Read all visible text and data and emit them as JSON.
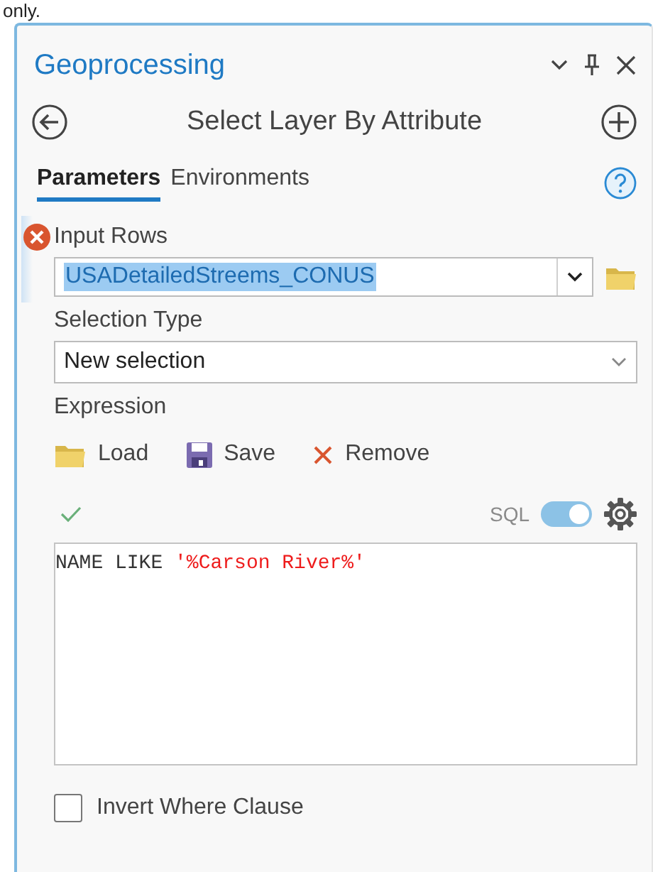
{
  "caption": "only.",
  "pane": {
    "title": "Geoprocessing"
  },
  "tool": {
    "title": "Select Layer By Attribute"
  },
  "tabs": [
    {
      "label": "Parameters",
      "selected": true
    },
    {
      "label": "Environments",
      "selected": false
    }
  ],
  "input_rows": {
    "label": "Input Rows",
    "error": true,
    "focused": true,
    "value": "USADetailedStreems_CONUS",
    "text_selected": true
  },
  "selection_type": {
    "label": "Selection Type",
    "value": "New selection"
  },
  "expression": {
    "label": "Expression",
    "actions": [
      {
        "kind": "load",
        "label": "Load"
      },
      {
        "kind": "save",
        "label": "Save"
      },
      {
        "kind": "remove",
        "label": "Remove"
      }
    ],
    "valid": true,
    "sql_label": "SQL",
    "sql_on": true,
    "clause": "NAME LIKE",
    "literal": "'%Carson River%'"
  },
  "invert_where_clause": {
    "label": "Invert Where Clause",
    "checked": false
  }
}
